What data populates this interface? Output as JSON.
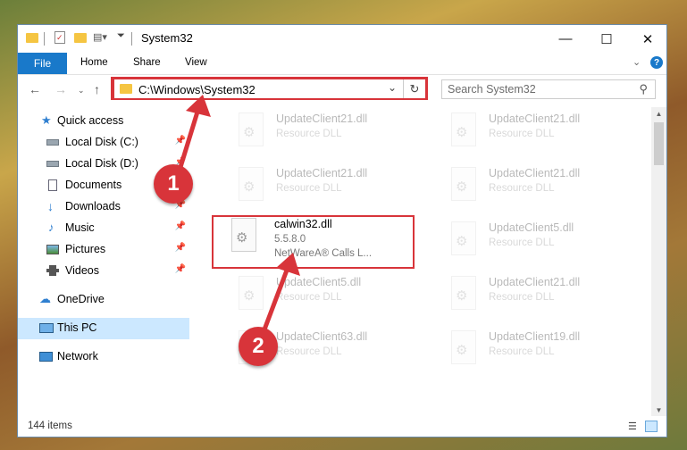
{
  "window": {
    "title": "System32",
    "controls": {
      "minimize": "—",
      "maximize": "☐",
      "close": "✕"
    }
  },
  "ribbon": {
    "file": "File",
    "tabs": [
      "Home",
      "Share",
      "View"
    ]
  },
  "address": {
    "path": "C:\\Windows\\System32",
    "search_placeholder": "Search System32"
  },
  "nav": {
    "items": [
      {
        "label": "Quick access",
        "icon": "star-icon"
      },
      {
        "label": "Local Disk (C:)",
        "icon": "drive-icon"
      },
      {
        "label": "Local Disk (D:)",
        "icon": "drive-icon"
      },
      {
        "label": "Documents",
        "icon": "documents-icon"
      },
      {
        "label": "Downloads",
        "icon": "download-icon"
      },
      {
        "label": "Music",
        "icon": "music-icon"
      },
      {
        "label": "Pictures",
        "icon": "pictures-icon"
      },
      {
        "label": "Videos",
        "icon": "videos-icon"
      },
      {
        "label": "OneDrive",
        "icon": "cloud-icon"
      },
      {
        "label": "This PC",
        "icon": "pc-icon"
      },
      {
        "label": "Network",
        "icon": "network-icon"
      }
    ]
  },
  "files": [
    {
      "name": "UpdateClient21.dll",
      "desc": "Resource DLL"
    },
    {
      "name": "UpdateClient21.dll",
      "desc": "Resource DLL"
    },
    {
      "name": "UpdateClient21.dll",
      "desc": "Resource DLL"
    },
    {
      "name": "UpdateClient21.dll",
      "desc": "Resource DLL"
    },
    {
      "name": "calwin32.dll",
      "version": "5.5.8.0",
      "desc": "NetWareA® Calls L..."
    },
    {
      "name": "UpdateClient5.dll",
      "desc": "Resource DLL"
    },
    {
      "name": "UpdateClient5.dll",
      "desc": "Resource DLL"
    },
    {
      "name": "UpdateClient21.dll",
      "desc": "Resource DLL"
    },
    {
      "name": "UpdateClient63.dll",
      "desc": "Resource DLL"
    },
    {
      "name": "UpdateClient19.dll",
      "desc": "Resource DLL"
    }
  ],
  "status": {
    "count": "144 items"
  },
  "callouts": {
    "one": "1",
    "two": "2"
  },
  "colors": {
    "accent": "#1979ca",
    "highlight": "#d8343a"
  }
}
